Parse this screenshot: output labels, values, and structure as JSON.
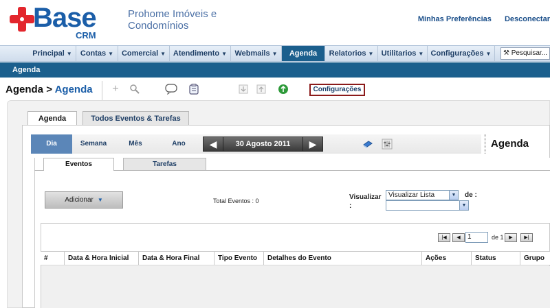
{
  "brand": {
    "name": "Base",
    "sub": "CRM",
    "color": "#1b5ea8",
    "cross_color": "#e3262d"
  },
  "company": {
    "name": "Prohome Imóveis e Condomínios"
  },
  "top_links": [
    "Minhas Preferências",
    "Desconectar"
  ],
  "nav": {
    "items": [
      {
        "label": "Principal",
        "caret": "▼"
      },
      {
        "label": "Contas",
        "caret": "▼"
      },
      {
        "label": "Comercial",
        "caret": "▼"
      },
      {
        "label": "Atendimento",
        "caret": "▼"
      },
      {
        "label": "Webmails",
        "caret": "▼"
      },
      {
        "label": "Agenda",
        "caret": ""
      },
      {
        "label": "Relatorios",
        "caret": "▼"
      },
      {
        "label": "Utilitarios",
        "caret": "▼"
      },
      {
        "label": "Configurações",
        "caret": "▼"
      }
    ],
    "active": "Agenda",
    "search_placeholder": "Pesquisar..."
  },
  "subbar": {
    "title": "Agenda"
  },
  "breadcrumb": {
    "root": "Agenda",
    "sep": ">",
    "current": "Agenda"
  },
  "toolbar": {
    "icons": [
      "add-icon",
      "search-icon",
      "chat-icon",
      "clipboard-icon",
      "import-icon",
      "export-icon",
      "refresh-icon"
    ],
    "config_label": "Configurações"
  },
  "tabs": [
    {
      "label": "Agenda",
      "active": true
    },
    {
      "label": "Todos Eventos & Tarefas",
      "active": false
    }
  ],
  "calendar": {
    "views": [
      {
        "label": "Dia",
        "active": true
      },
      {
        "label": "Semana",
        "active": false
      },
      {
        "label": "Mês",
        "active": false
      },
      {
        "label": "Ano",
        "active": false
      }
    ],
    "prev": "◀",
    "next": "▶",
    "date": "30 Agosto 2011",
    "title": "Agenda"
  },
  "subtabs": [
    {
      "label": "Eventos",
      "active": true
    },
    {
      "label": "Tarefas",
      "active": false
    }
  ],
  "events": {
    "add_label": "Adicionar",
    "add_caret": "▼",
    "total_label": "Total Eventos : 0",
    "visualizar_label": "Visualizar :",
    "visualizar_value": "Visualizar Lista",
    "de_label": "de :",
    "de_value": "",
    "dd_glyph": "▼"
  },
  "pager": {
    "first": "|◀",
    "prev": "◀",
    "page": "1",
    "of_label": "de 1",
    "next": "▶",
    "last": "▶|"
  },
  "table": {
    "columns": [
      "#",
      "Data & Hora Inicial",
      "Data & Hora Final",
      "Tipo Evento",
      "Detalhes do Evento",
      "Ações",
      "Status",
      "Grupo"
    ]
  }
}
